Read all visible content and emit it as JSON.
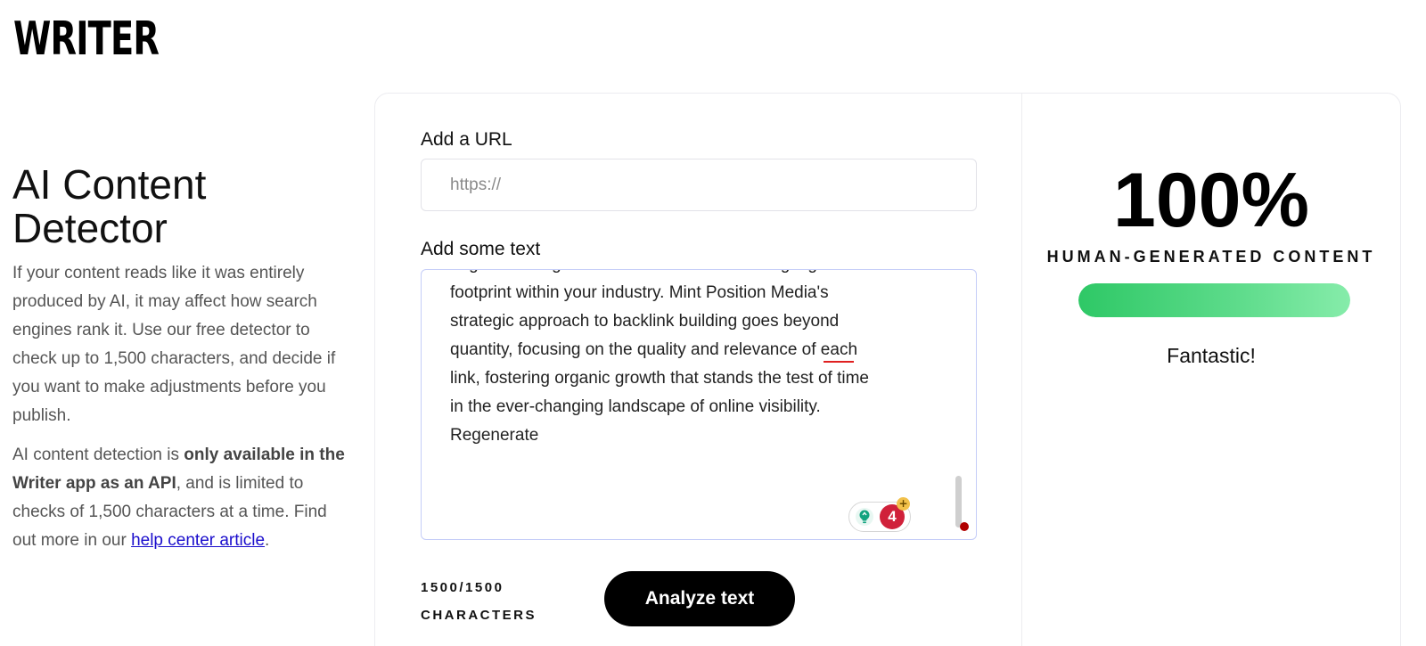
{
  "brand": {
    "logo_text": "WRITER"
  },
  "intro": {
    "title_line1": "AI Content",
    "title_line2": "Detector",
    "paragraph1": "If your content reads like it was entirely produced by AI, it may affect how search engines rank it. Use our free detector to check up to 1,500 characters, and decide if you want to make adjustments before you publish.",
    "paragraph2_start": "AI content detection is ",
    "paragraph2_bold": "only available in the Writer app as an API",
    "paragraph2_mid": ", and is limited to checks of 1,500 characters at a time. Find out more in our ",
    "paragraph2_link": "help center article",
    "paragraph2_end": "."
  },
  "form": {
    "url_label": "Add a URL",
    "url_placeholder": "https://",
    "text_label": "Add some text",
    "text_lines": [
      "engine rankings and establish a commanding digital",
      "footprint within your industry. Mint Position Media's",
      "strategic approach to backlink building goes beyond",
      "quantity, focusing on the quality and relevance of each",
      "link, fostering organic growth that stands the test of time",
      "in the ever-changing landscape of online visibility.",
      "Regenerate"
    ],
    "grammar_issue_count": "4",
    "grammar_plus": "+",
    "char_count": "1500/1500",
    "char_unit": "CHARACTERS",
    "analyze_button": "Analyze text"
  },
  "result": {
    "score": "100%",
    "score_label": "HUMAN-GENERATED CONTENT",
    "human_fraction": 1.0,
    "verdict": "Fantastic!"
  },
  "colors": {
    "accent_green": "#2ec866",
    "button_bg": "#000000",
    "link": "#1a0dcc",
    "badge_red": "#d0213a"
  }
}
